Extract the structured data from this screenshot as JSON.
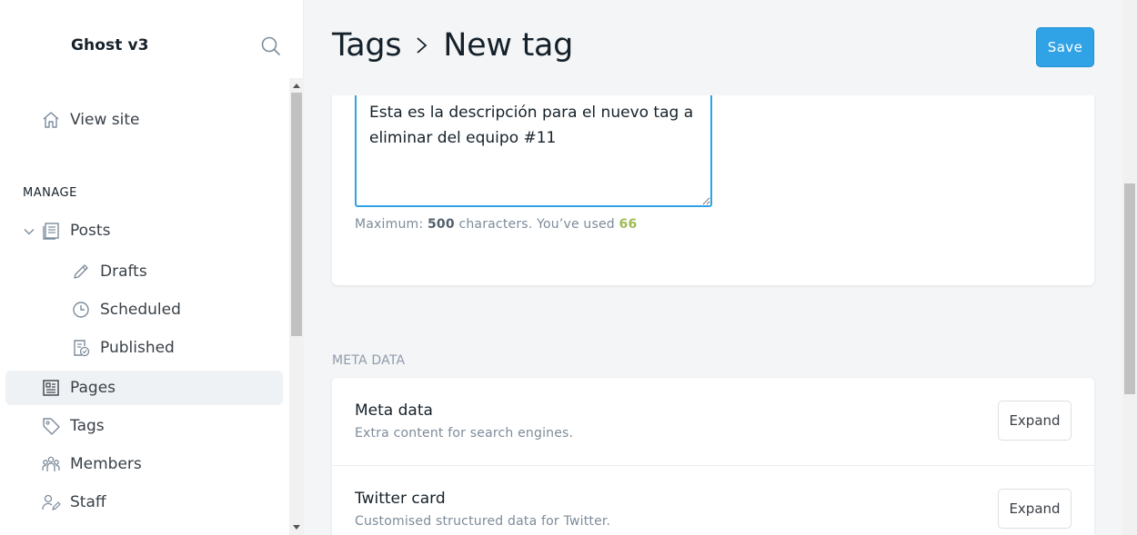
{
  "sidebar": {
    "site_title": "Ghost v3",
    "view_site": "View site",
    "manage_label": "MANAGE",
    "posts": "Posts",
    "drafts": "Drafts",
    "scheduled": "Scheduled",
    "published": "Published",
    "pages": "Pages",
    "tags": "Tags",
    "members": "Members",
    "staff": "Staff",
    "active_item": "Pages"
  },
  "header": {
    "breadcrumb_parent": "Tags",
    "breadcrumb_current": "New tag",
    "save_label": "Save",
    "accent_color": "#30a3e6"
  },
  "description": {
    "value": "Esta es la descripción para el nuevo tag a eliminar del equipo #11",
    "helper_prefix": "Maximum:",
    "max_chars": "500",
    "helper_middle": "characters. You’ve used",
    "used_chars": "66"
  },
  "meta_section": {
    "label": "META DATA",
    "rows": [
      {
        "title": "Meta data",
        "subtitle": "Extra content for search engines.",
        "button": "Expand"
      },
      {
        "title": "Twitter card",
        "subtitle": "Customised structured data for Twitter.",
        "button": "Expand"
      }
    ]
  }
}
